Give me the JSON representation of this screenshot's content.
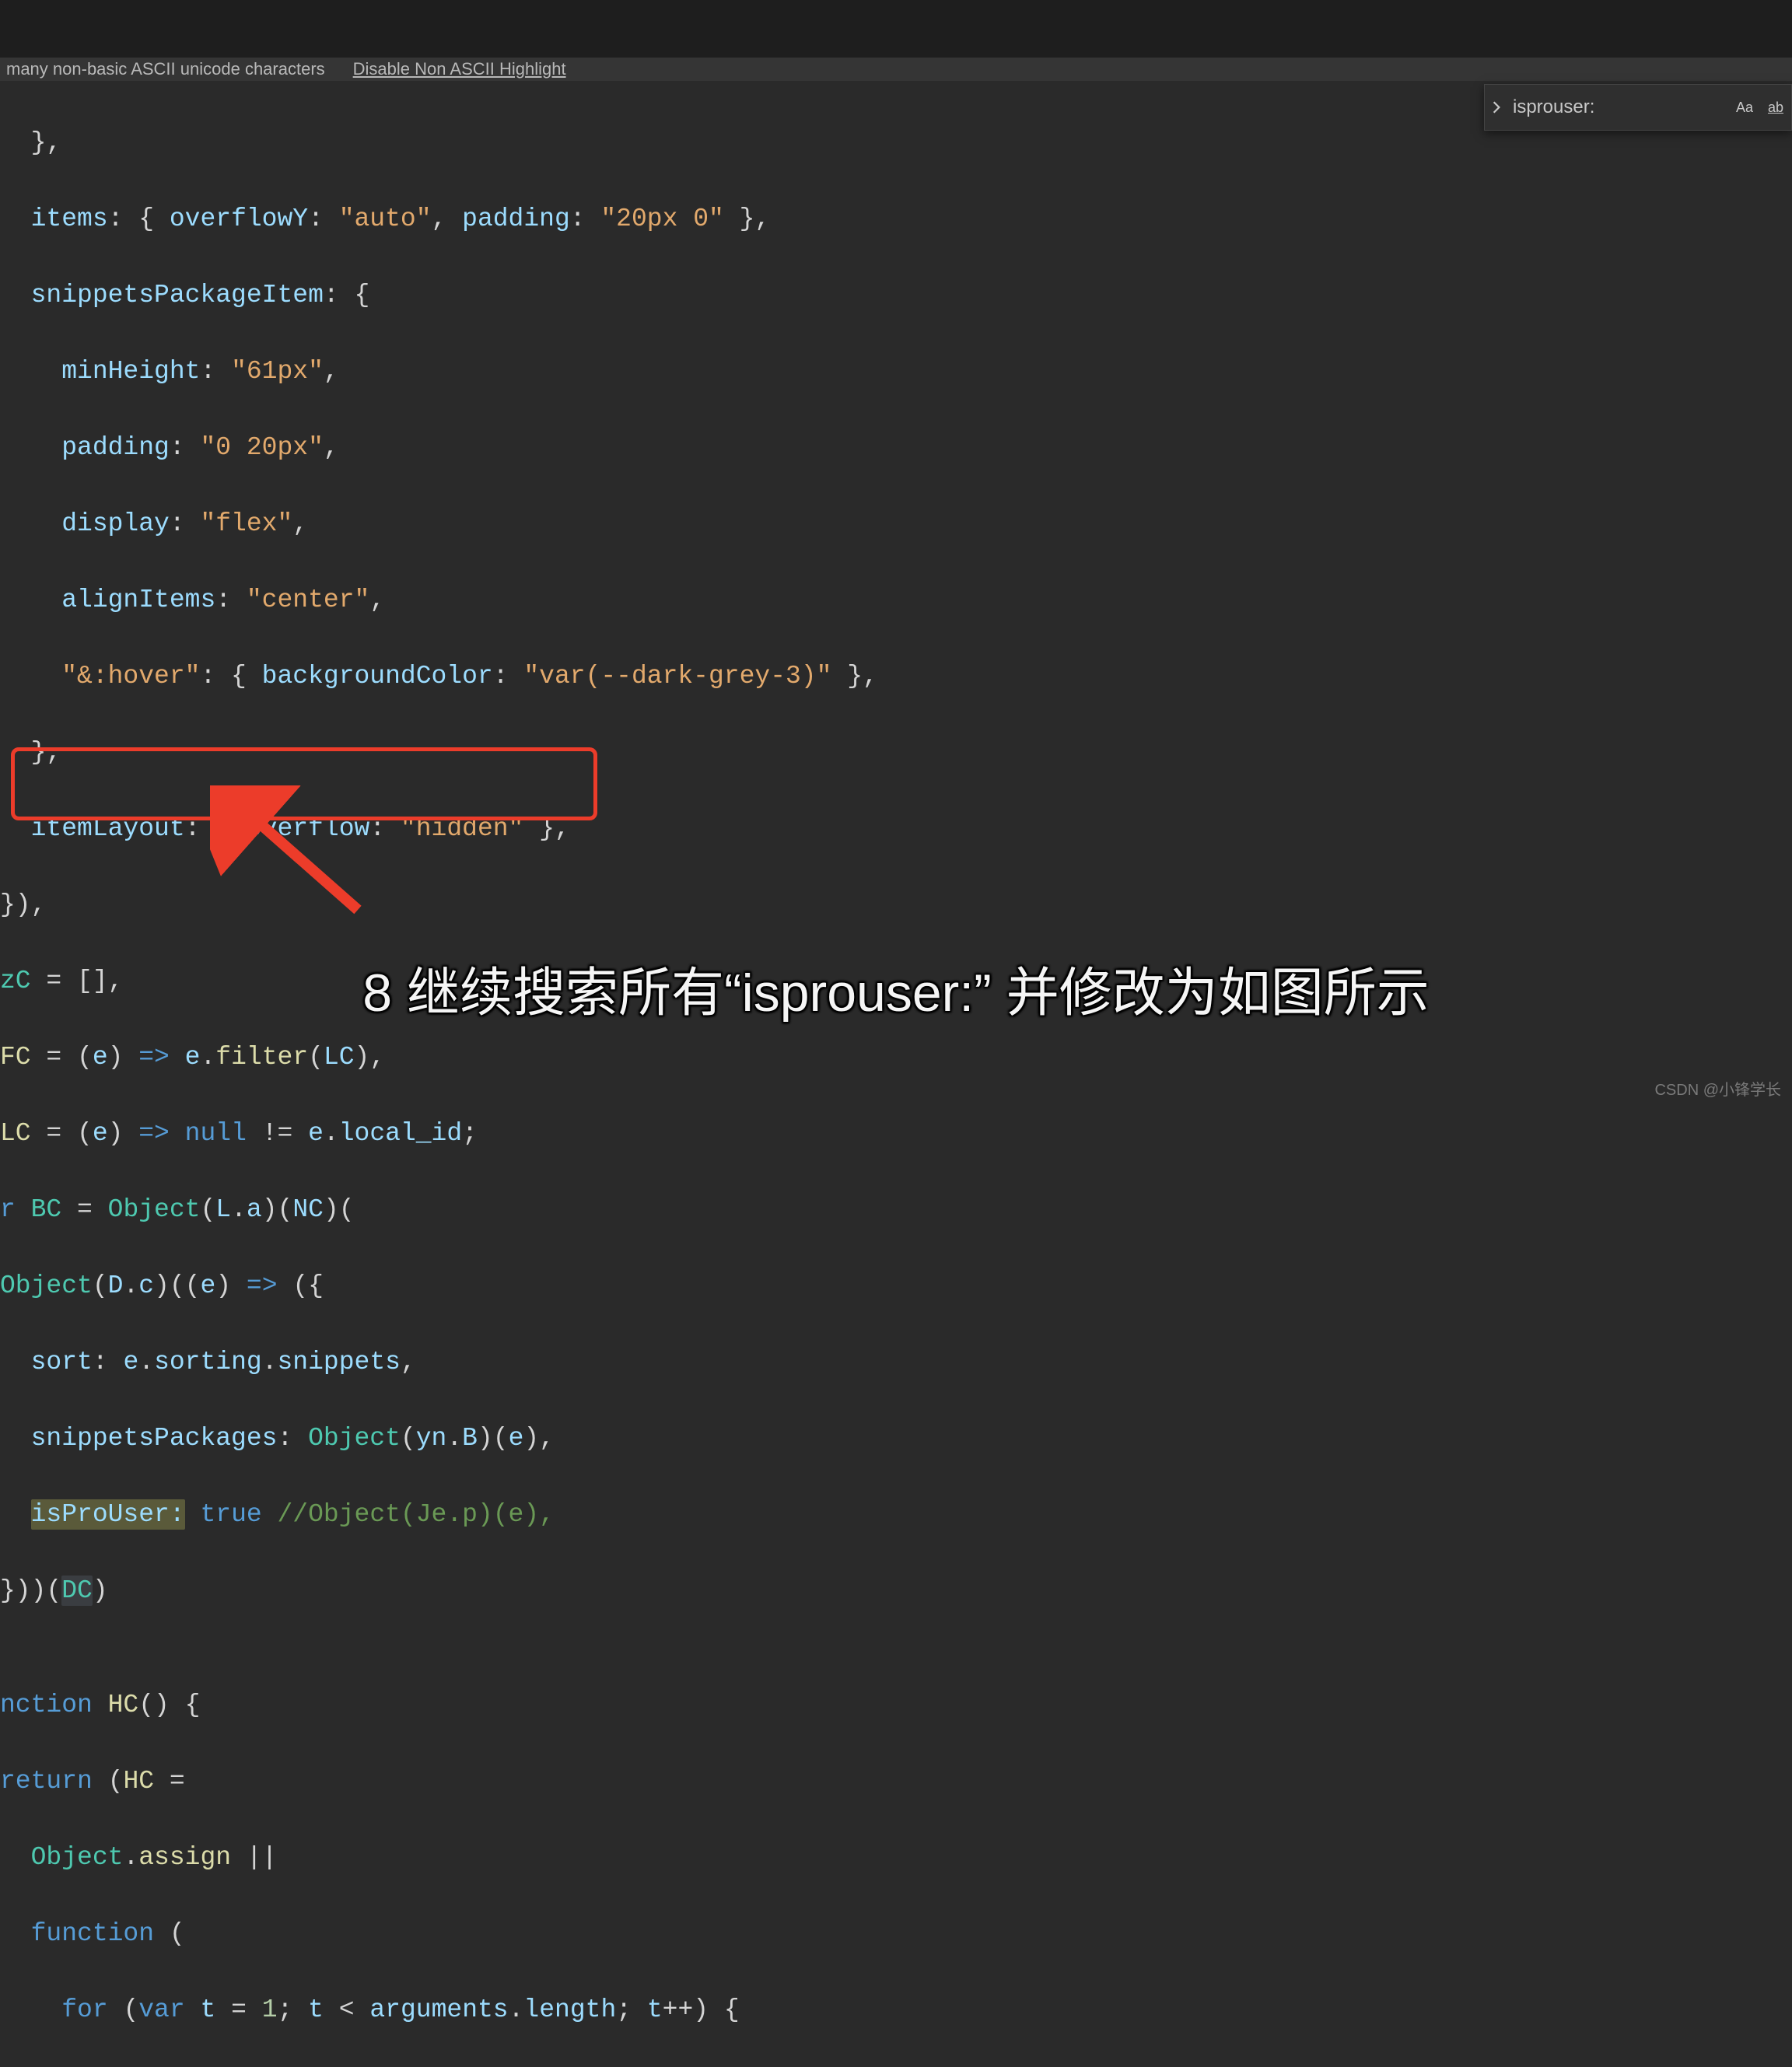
{
  "notification": {
    "message": "many non-basic ASCII unicode characters",
    "link": "Disable Non ASCII Highlight"
  },
  "find": {
    "value": "isprouser:",
    "case_label": "Aa",
    "wholeword_label": "ab"
  },
  "code": {
    "l1_a": "  },",
    "l2_a": "  ",
    "l2_b": "items",
    "l2_c": ": { ",
    "l2_d": "overflowY",
    "l2_e": ": ",
    "l2_f": "\"auto\"",
    "l2_g": ", ",
    "l2_h": "padding",
    "l2_i": ": ",
    "l2_j": "\"20px 0\"",
    "l2_k": " },",
    "l3_a": "  ",
    "l3_b": "snippetsPackageItem",
    "l3_c": ": {",
    "l4_a": "    ",
    "l4_b": "minHeight",
    "l4_c": ": ",
    "l4_d": "\"61px\"",
    "l4_e": ",",
    "l5_a": "    ",
    "l5_b": "padding",
    "l5_c": ": ",
    "l5_d": "\"0 20px\"",
    "l5_e": ",",
    "l6_a": "    ",
    "l6_b": "display",
    "l6_c": ": ",
    "l6_d": "\"flex\"",
    "l6_e": ",",
    "l7_a": "    ",
    "l7_b": "alignItems",
    "l7_c": ": ",
    "l7_d": "\"center\"",
    "l7_e": ",",
    "l8_a": "    ",
    "l8_b": "\"&:hover\"",
    "l8_c": ": { ",
    "l8_d": "backgroundColor",
    "l8_e": ": ",
    "l8_f": "\"var(--dark-grey-3)\"",
    "l8_g": " },",
    "l9_a": "  },",
    "l10_a": "  ",
    "l10_b": "itemLayout",
    "l10_c": ": { ",
    "l10_d": "overflow",
    "l10_e": ": ",
    "l10_f": "\"hidden\"",
    "l10_g": " },",
    "l11_a": "}),",
    "l12_a": "zC",
    "l12_b": " = [],",
    "l13_a": "FC",
    "l13_b": " = (",
    "l13_c": "e",
    "l13_d": ") ",
    "l13_e": "=>",
    "l13_f": " ",
    "l13_g": "e",
    "l13_h": ".",
    "l13_i": "filter",
    "l13_j": "(",
    "l13_k": "LC",
    "l13_l": "),",
    "l14_a": "LC",
    "l14_b": " = (",
    "l14_c": "e",
    "l14_d": ") ",
    "l14_e": "=>",
    "l14_f": " ",
    "l14_g": "null",
    "l14_h": " != ",
    "l14_i": "e",
    "l14_j": ".",
    "l14_k": "local_id",
    "l14_l": ";",
    "l15_a": "r ",
    "l15_b": "BC",
    "l15_c": " = ",
    "l15_d": "Object",
    "l15_e": "(",
    "l15_f": "L",
    "l15_g": ".",
    "l15_h": "a",
    "l15_i": ")(",
    "l15_j": "NC",
    "l15_k": ")(",
    "l16_a": "Object",
    "l16_b": "(",
    "l16_c": "D",
    "l16_d": ".",
    "l16_e": "c",
    "l16_f": ")((",
    "l16_g": "e",
    "l16_h": ") ",
    "l16_i": "=>",
    "l16_j": " ({",
    "l17_a": "  ",
    "l17_b": "sort",
    "l17_c": ": ",
    "l17_d": "e",
    "l17_e": ".",
    "l17_f": "sorting",
    "l17_g": ".",
    "l17_h": "snippets",
    "l17_i": ",",
    "l18_a": "  ",
    "l18_b": "snippetsPackages",
    "l18_c": ": ",
    "l18_d": "Object",
    "l18_e": "(",
    "l18_f": "yn",
    "l18_g": ".",
    "l18_h": "B",
    "l18_i": ")(",
    "l18_j": "e",
    "l18_k": "),",
    "l19_a": "  ",
    "l19_b": "isProUser:",
    "l19_c": " ",
    "l19_d": "true",
    "l19_e": " ",
    "l19_f": "//Object(Je.p)(e),",
    "l20_a": "}))(",
    "l20_b": "DC",
    "l20_c": ")",
    "l21_a": "",
    "l22_a": "nction ",
    "l22_b": "HC",
    "l22_c": "() {",
    "l23_a": "return",
    "l23_b": " (",
    "l23_c": "HC",
    "l23_d": " =",
    "l24_a": "  ",
    "l24_b": "Object",
    "l24_c": ".",
    "l24_d": "assign",
    "l24_e": " ||",
    "l25_a": "  ",
    "l25_b": "function",
    "l25_c": " (",
    "l26_a": "    ",
    "l26_b": "for",
    "l26_c": " (",
    "l26_d": "var",
    "l26_e": " ",
    "l26_f": "t",
    "l26_g": " = ",
    "l26_h": "1",
    "l26_i": "; ",
    "l26_j": "t",
    "l26_k": " < ",
    "l26_l": "arguments",
    "l26_m": ".",
    "l26_n": "length",
    "l26_o": "; ",
    "l26_p": "t",
    "l26_q": "++) {"
  },
  "subtitle": "8 继续搜索所有“isprouser:” 并修改为如图所示",
  "watermark": "CSDN @小锋学长"
}
